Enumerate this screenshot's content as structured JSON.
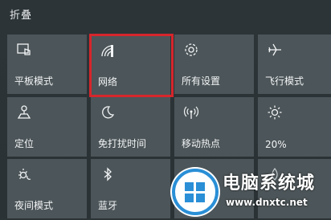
{
  "header": {
    "collapse_label": "折叠"
  },
  "tiles": [
    {
      "label": "平板模式",
      "icon": "tablet-mode-icon"
    },
    {
      "label": "网络",
      "icon": "network-icon"
    },
    {
      "label": "所有设置",
      "icon": "settings-gear-icon"
    },
    {
      "label": "飞行模式",
      "icon": "airplane-icon"
    },
    {
      "label": "定位",
      "icon": "location-icon"
    },
    {
      "label": "免打扰时间",
      "icon": "moon-icon"
    },
    {
      "label": "移动热点",
      "icon": "hotspot-icon"
    },
    {
      "label": "20%",
      "icon": "brightness-icon"
    },
    {
      "label": "夜间模式",
      "icon": "night-light-icon"
    },
    {
      "label": "蓝牙",
      "icon": "bluetooth-icon"
    },
    {
      "label": "",
      "icon": "vpn-icon"
    },
    {
      "label": "",
      "icon": "focus-icon"
    }
  ],
  "watermark": {
    "brand": "电脑系统城",
    "url": "www.dnxtc.net"
  },
  "colors": {
    "tile": "#4c5559",
    "background": "#2b3337",
    "highlight": "#d6262c"
  }
}
